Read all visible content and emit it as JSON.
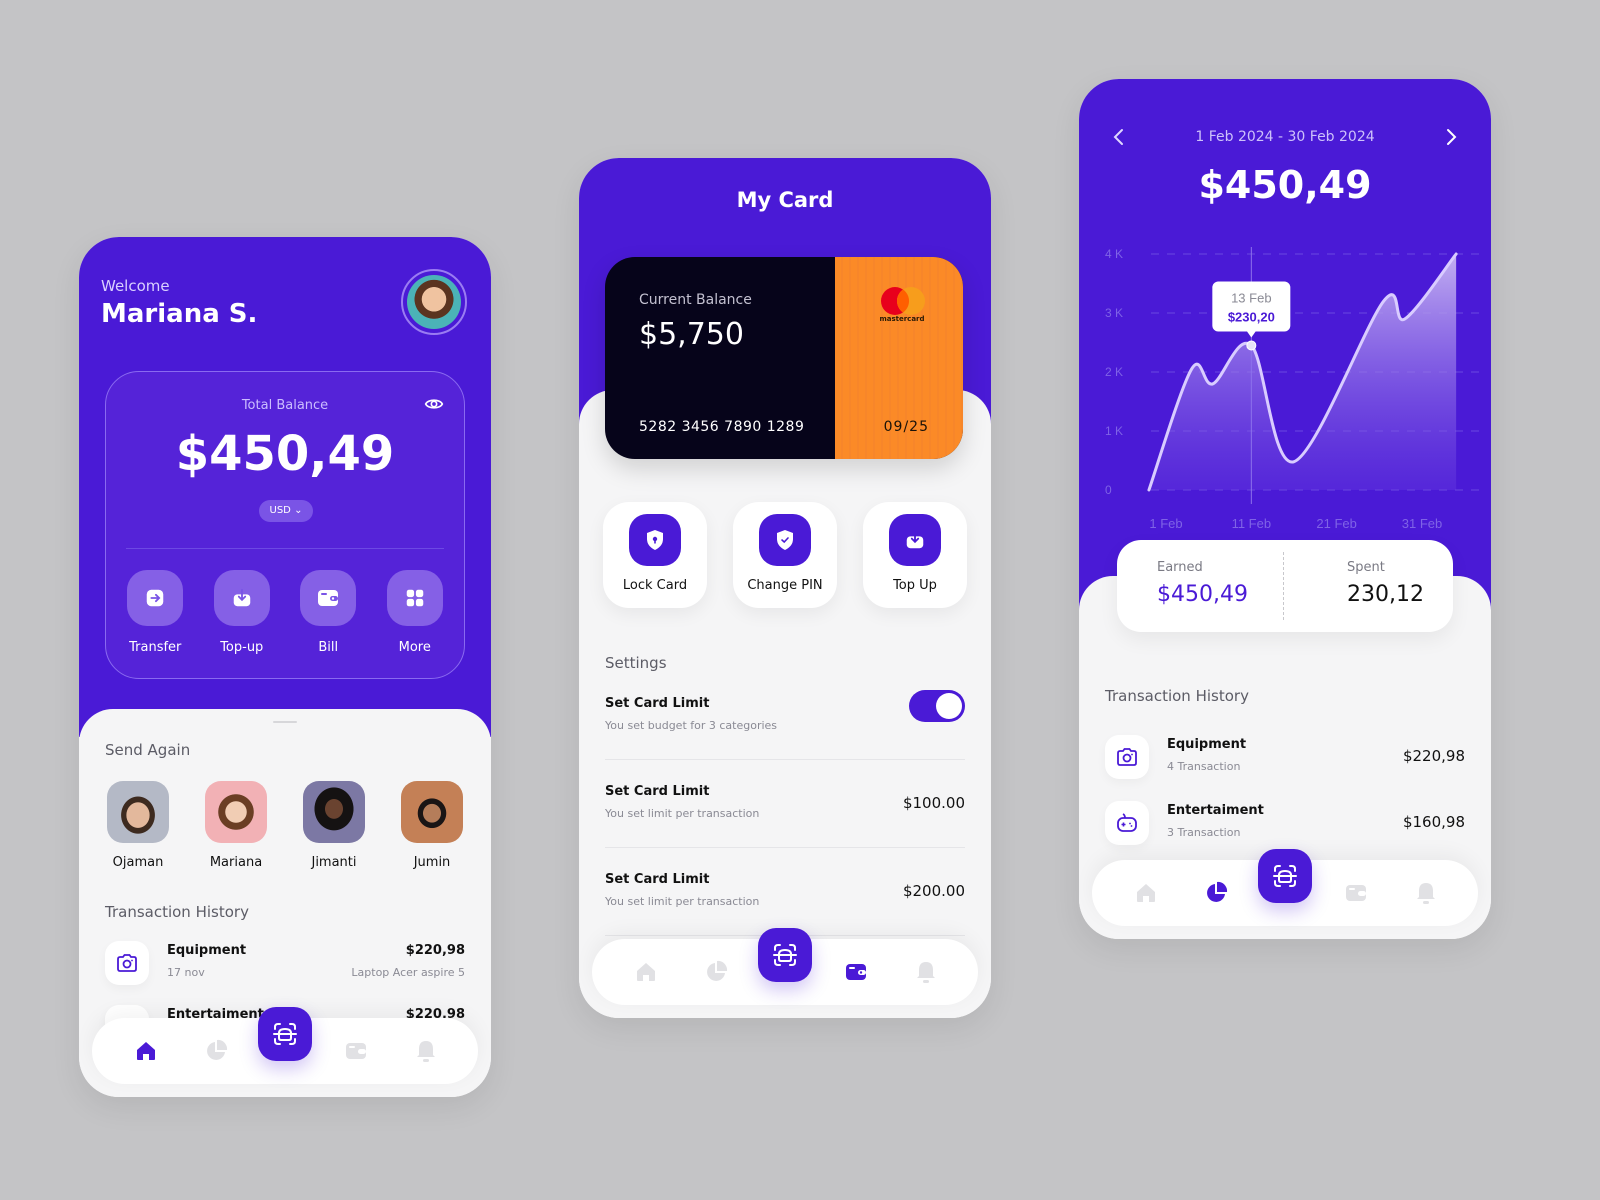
{
  "colors": {
    "primary": "#4a1ad6",
    "card_dark": "#06041a",
    "card_orange": "#fb8a27",
    "background": "#c4c4c6"
  },
  "home": {
    "welcome": "Welcome",
    "user_name": "Mariana S.",
    "balance": {
      "label": "Total Balance",
      "amount": "$450,49",
      "currency": "USD"
    },
    "actions": [
      {
        "label": "Transfer",
        "icon": "transfer-icon"
      },
      {
        "label": "Top-up",
        "icon": "top-up-icon"
      },
      {
        "label": "Bill",
        "icon": "wallet-icon"
      },
      {
        "label": "More",
        "icon": "grid-icon"
      }
    ],
    "send_again": {
      "title": "Send Again",
      "contacts": [
        {
          "name": "Ojaman"
        },
        {
          "name": "Mariana"
        },
        {
          "name": "Jimanti"
        },
        {
          "name": "Jumin"
        }
      ]
    },
    "transactions": {
      "title": "Transaction History",
      "items": [
        {
          "name": "Equipment",
          "sub": "17 nov",
          "amount": "$220,98",
          "note": "Laptop Acer aspire 5",
          "icon": "camera-icon"
        },
        {
          "name": "Entertaiment",
          "sub": "",
          "amount": "$220,98",
          "note": "",
          "icon": "gamepad-icon"
        }
      ]
    },
    "nav": {
      "active": "home"
    }
  },
  "card": {
    "title": "My Card",
    "current_balance_label": "Current Balance",
    "current_balance": "$5,750",
    "card_number": "5282 3456 7890 1289",
    "expiry": "09/25",
    "brand": "mastercard",
    "quick_actions": [
      {
        "label": "Lock Card",
        "icon": "lock-shield-icon"
      },
      {
        "label": "Change PIN",
        "icon": "check-shield-icon"
      },
      {
        "label": "Top Up",
        "icon": "top-up-icon"
      }
    ],
    "settings_title": "Settings",
    "settings": [
      {
        "name": "Set Card Limit",
        "desc": "You set budget for 3 categories",
        "toggle": true,
        "value": ""
      },
      {
        "name": "Set Card Limit",
        "desc": "You set limit per transaction",
        "toggle": false,
        "value": "$100.00"
      },
      {
        "name": "Set Card Limit",
        "desc": "You set limit per transaction",
        "toggle": false,
        "value": "$200.00"
      }
    ],
    "nav": {
      "active": "wallet"
    }
  },
  "stats": {
    "date_range": "1 Feb 2024 - 30 Feb 2024",
    "total": "$450,49",
    "tooltip": {
      "date": "13 Feb",
      "value": "$230,20"
    },
    "summary": {
      "earned_label": "Earned",
      "earned": "$450,49",
      "spent_label": "Spent",
      "spent": "230,12"
    },
    "transactions": {
      "title": "Transaction History",
      "items": [
        {
          "name": "Equipment",
          "sub": "4 Transaction",
          "amount": "$220,98",
          "icon": "camera-icon"
        },
        {
          "name": "Entertaiment",
          "sub": "3 Transaction",
          "amount": "$160,98",
          "icon": "gamepad-icon"
        }
      ]
    },
    "nav": {
      "active": "stats"
    }
  },
  "chart_data": {
    "type": "area",
    "title": "",
    "xlabel": "",
    "ylabel": "",
    "x_ticks": [
      "1 Feb",
      "11 Feb",
      "21 Feb",
      "31 Feb"
    ],
    "x_tick_days": [
      1,
      11,
      21,
      31
    ],
    "y_ticks": [
      "0",
      "1 K",
      "2 K",
      "3 K",
      "4 K"
    ],
    "y_tick_values": [
      0,
      1000,
      2000,
      3000,
      4000
    ],
    "ylim": [
      0,
      4000
    ],
    "xlim": [
      -1,
      35
    ],
    "grid": true,
    "series": [
      {
        "name": "balance",
        "x": [
          -1,
          4,
          6.5,
          11,
          16,
          26.5,
          29,
          35
        ],
        "values": [
          0,
          2050,
          1800,
          2450,
          480,
          3200,
          2900,
          4000
        ]
      }
    ],
    "highlight": {
      "x": 11,
      "value": 2450,
      "label_date": "13 Feb",
      "label_value": "$230,20"
    }
  }
}
